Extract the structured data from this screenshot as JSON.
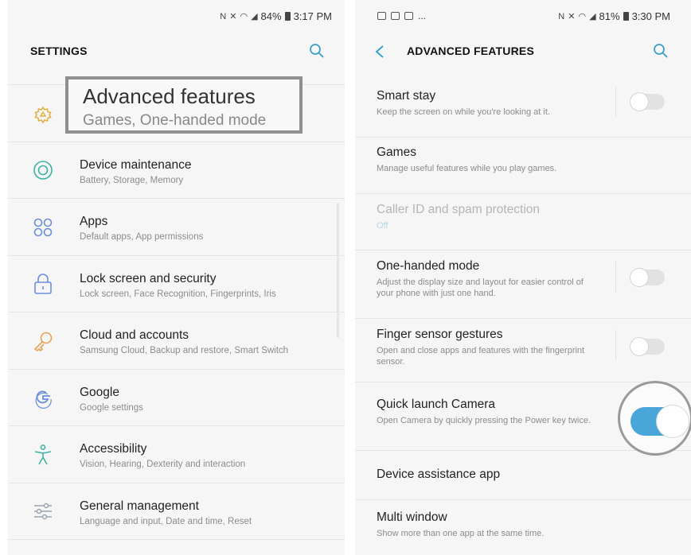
{
  "left": {
    "status": {
      "battery": "84%",
      "time": "3:17 PM"
    },
    "header": {
      "title": "SETTINGS",
      "search_icon": "search-icon"
    },
    "highlight": {
      "title": "Advanced features",
      "subtitle": "Games, One-handed mode"
    },
    "items": [
      {
        "title": "Device maintenance",
        "subtitle": "Battery, Storage, Memory",
        "icon": "maintenance-icon"
      },
      {
        "title": "Apps",
        "subtitle": "Default apps, App permissions",
        "icon": "apps-icon"
      },
      {
        "title": "Lock screen and security",
        "subtitle": "Lock screen, Face Recognition, Fingerprints, Iris",
        "icon": "lock-icon"
      },
      {
        "title": "Cloud and accounts",
        "subtitle": "Samsung Cloud, Backup and restore, Smart Switch",
        "icon": "key-icon"
      },
      {
        "title": "Google",
        "subtitle": "Google settings",
        "icon": "google-icon"
      },
      {
        "title": "Accessibility",
        "subtitle": "Vision, Hearing, Dexterity and interaction",
        "icon": "accessibility-icon"
      },
      {
        "title": "General management",
        "subtitle": "Language and input, Date and time, Reset",
        "icon": "sliders-icon"
      }
    ]
  },
  "right": {
    "status": {
      "notif": "...",
      "battery": "81%",
      "time": "3:30 PM"
    },
    "header": {
      "title": "ADVANCED FEATURES"
    },
    "items": [
      {
        "title": "Smart stay",
        "subtitle": "Keep the screen on while you're looking at it.",
        "toggle": false
      },
      {
        "title": "Games",
        "subtitle": "Manage useful features while you play games."
      },
      {
        "title": "Caller ID and spam protection",
        "subtitle": "Off",
        "disabled": true
      },
      {
        "title": "One-handed mode",
        "subtitle": "Adjust the display size and layout for easier control of your phone with just one hand.",
        "toggle": false
      },
      {
        "title": "Finger sensor gestures",
        "subtitle": "Open and close apps and features with the fingerprint sensor.",
        "toggle": false
      },
      {
        "title": "Quick launch Camera",
        "subtitle": "Open Camera by quickly pressing the Power key twice.",
        "toggle": true
      },
      {
        "title": "Device assistance app",
        "subtitle": ""
      },
      {
        "title": "Multi window",
        "subtitle": "Show more than one app at the same time."
      }
    ]
  },
  "colors": {
    "accent": "#4aa6d8",
    "icon_blue": "#6a8fd8",
    "icon_teal": "#3db3a4",
    "icon_orange": "#e8a256",
    "icon_gold": "#e2b145"
  }
}
